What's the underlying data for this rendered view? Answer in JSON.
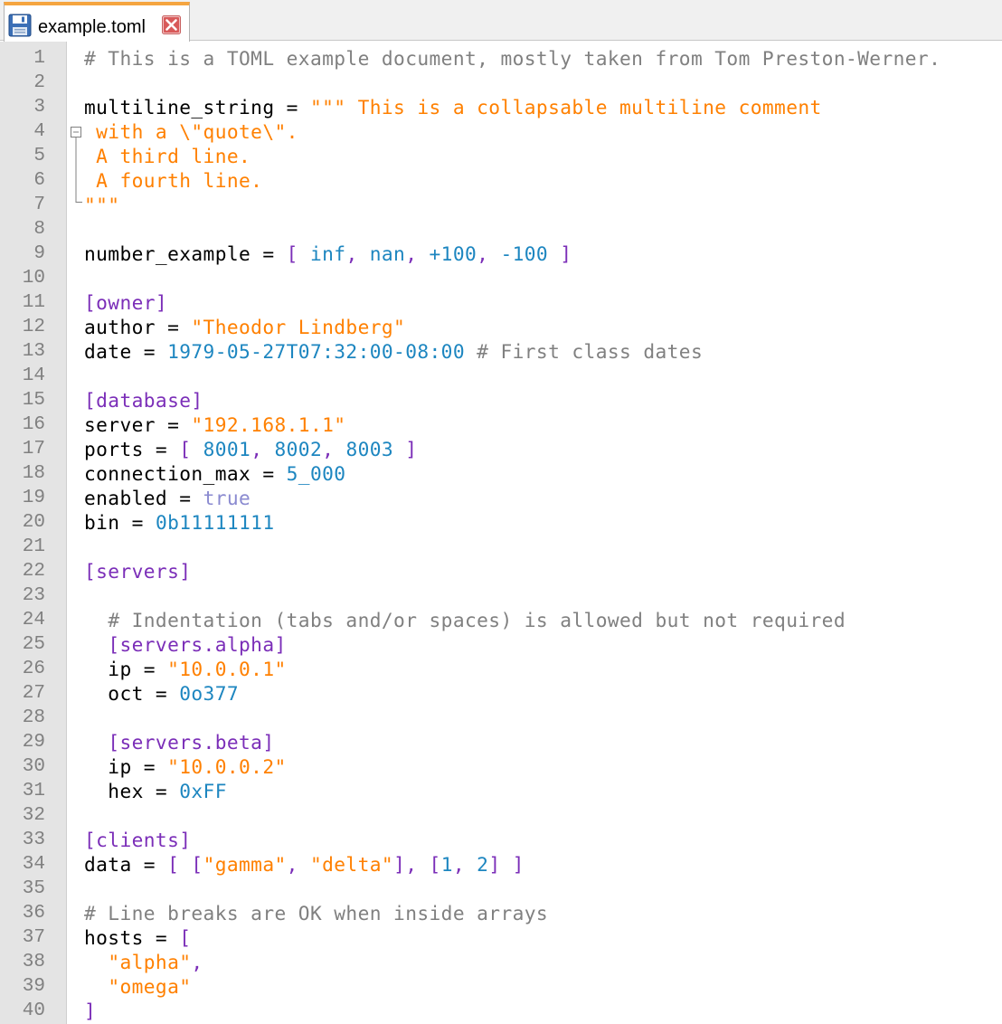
{
  "tab": {
    "filename": "example.toml"
  },
  "colors": {
    "key": "#000000",
    "string": "#ff8000",
    "comment": "#808080",
    "number": "#1d86c0",
    "bracket": "#7b2eb8",
    "boolean": "#8a8ad0",
    "tab_accent": "#f5a540",
    "gutter": "#e4e4e4"
  },
  "icons": {
    "tab": "floppy-disk-icon",
    "close": "close-x-icon",
    "fold": "fold-minus-icon"
  },
  "lines": [
    [
      [
        "c",
        "# This is a TOML example document, mostly taken from Tom Preston-Werner."
      ]
    ],
    [],
    [
      [
        "k",
        "multiline_string = "
      ],
      [
        "s",
        "\"\"\" This is a collapsable multiline comment"
      ]
    ],
    [
      [
        "s",
        " with a \\\"quote\\\"."
      ]
    ],
    [
      [
        "s",
        " A third line."
      ]
    ],
    [
      [
        "s",
        " A fourth line."
      ]
    ],
    [
      [
        "s",
        "\"\"\""
      ]
    ],
    [],
    [
      [
        "k",
        "number_example = "
      ],
      [
        "b",
        "[ "
      ],
      [
        "n",
        "inf"
      ],
      [
        "b",
        ", "
      ],
      [
        "n",
        "nan"
      ],
      [
        "b",
        ", "
      ],
      [
        "n",
        "+100"
      ],
      [
        "b",
        ", "
      ],
      [
        "n",
        "-100"
      ],
      [
        "b",
        " ]"
      ]
    ],
    [],
    [
      [
        "b",
        "[owner]"
      ]
    ],
    [
      [
        "k",
        "author = "
      ],
      [
        "s",
        "\"Theodor Lindberg\""
      ]
    ],
    [
      [
        "k",
        "date = "
      ],
      [
        "n",
        "1979-05-27T07:32:00-08:00"
      ],
      [
        "c",
        " # First class dates"
      ]
    ],
    [],
    [
      [
        "b",
        "[database]"
      ]
    ],
    [
      [
        "k",
        "server = "
      ],
      [
        "s",
        "\"192.168.1.1\""
      ]
    ],
    [
      [
        "k",
        "ports = "
      ],
      [
        "b",
        "[ "
      ],
      [
        "n",
        "8001"
      ],
      [
        "b",
        ", "
      ],
      [
        "n",
        "8002"
      ],
      [
        "b",
        ", "
      ],
      [
        "n",
        "8003"
      ],
      [
        "b",
        " ]"
      ]
    ],
    [
      [
        "k",
        "connection_max = "
      ],
      [
        "n",
        "5_000"
      ]
    ],
    [
      [
        "k",
        "enabled = "
      ],
      [
        "t",
        "true"
      ]
    ],
    [
      [
        "k",
        "bin = "
      ],
      [
        "n",
        "0b11111111"
      ]
    ],
    [],
    [
      [
        "b",
        "[servers]"
      ]
    ],
    [],
    [
      [
        "k",
        "  "
      ],
      [
        "c",
        "# Indentation (tabs and/or spaces) is allowed but not required"
      ]
    ],
    [
      [
        "k",
        "  "
      ],
      [
        "b",
        "[servers.alpha]"
      ]
    ],
    [
      [
        "k",
        "  ip = "
      ],
      [
        "s",
        "\"10.0.0.1\""
      ]
    ],
    [
      [
        "k",
        "  oct = "
      ],
      [
        "n",
        "0o377"
      ]
    ],
    [],
    [
      [
        "k",
        "  "
      ],
      [
        "b",
        "[servers.beta]"
      ]
    ],
    [
      [
        "k",
        "  ip = "
      ],
      [
        "s",
        "\"10.0.0.2\""
      ]
    ],
    [
      [
        "k",
        "  hex = "
      ],
      [
        "n",
        "0xFF"
      ]
    ],
    [],
    [
      [
        "b",
        "[clients]"
      ]
    ],
    [
      [
        "k",
        "data = "
      ],
      [
        "b",
        "[ ["
      ],
      [
        "s",
        "\"gamma\""
      ],
      [
        "b",
        ", "
      ],
      [
        "s",
        "\"delta\""
      ],
      [
        "b",
        "], ["
      ],
      [
        "n",
        "1"
      ],
      [
        "b",
        ", "
      ],
      [
        "n",
        "2"
      ],
      [
        "b",
        "] ]"
      ]
    ],
    [],
    [
      [
        "c",
        "# Line breaks are OK when inside arrays"
      ]
    ],
    [
      [
        "k",
        "hosts = "
      ],
      [
        "b",
        "["
      ]
    ],
    [
      [
        "k",
        "  "
      ],
      [
        "s",
        "\"alpha\""
      ],
      [
        "b",
        ","
      ]
    ],
    [
      [
        "k",
        "  "
      ],
      [
        "s",
        "\"omega\""
      ]
    ],
    [
      [
        "b",
        "]"
      ]
    ]
  ]
}
